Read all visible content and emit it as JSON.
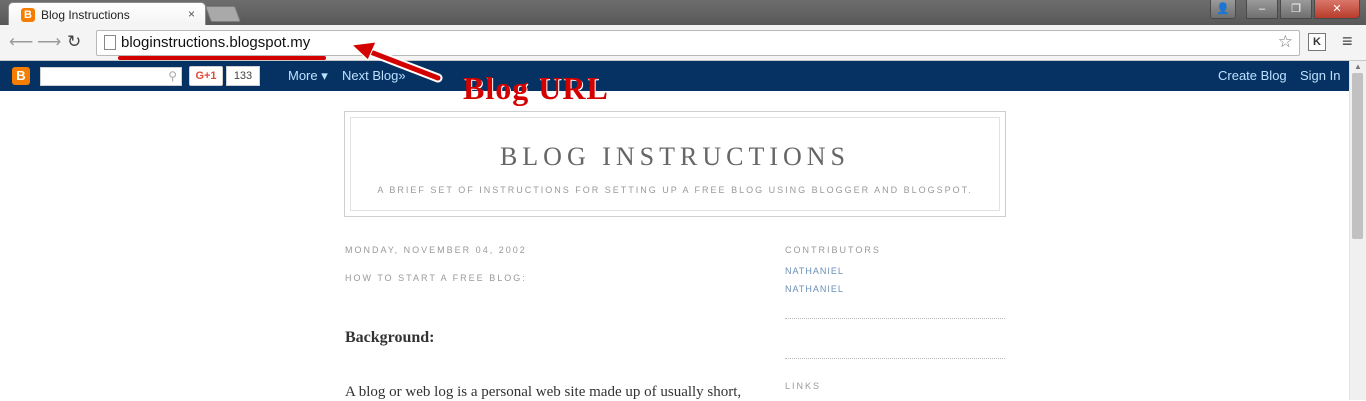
{
  "browser": {
    "tab_title": "Blog Instructions",
    "tab_close": "×",
    "url": "bloginstructions.blogspot.my",
    "ext_label": "K",
    "win_user": "👤",
    "win_minimize": "‒",
    "win_restore": "❐",
    "win_close": "✕"
  },
  "navbar": {
    "gplus_label": "G+1",
    "gplus_count": "133",
    "more_label": "More ▾",
    "next_blog_label": "Next Blog»",
    "create_blog_label": "Create Blog",
    "sign_in_label": "Sign In"
  },
  "blog": {
    "title": "BLOG INSTRUCTIONS",
    "description": "A BRIEF SET OF INSTRUCTIONS FOR SETTING UP A FREE BLOG USING BLOGGER AND BLOGSPOT."
  },
  "post": {
    "date": "MONDAY, NOVEMBER 04, 2002",
    "title": "HOW TO START A FREE BLOG:",
    "heading": "Background:",
    "body_start": "A blog or web log is a personal web site made up of usually short,"
  },
  "sidebar": {
    "contributors_heading": "CONTRIBUTORS",
    "contributors": [
      "NATHANIEL",
      "NATHANIEL"
    ],
    "links_heading": "LINKS"
  },
  "annotation": {
    "label": "Blog URL",
    "color": "#d40000"
  },
  "colors": {
    "navbar_bg": "#063263",
    "blogger_orange": "#f57d00"
  }
}
